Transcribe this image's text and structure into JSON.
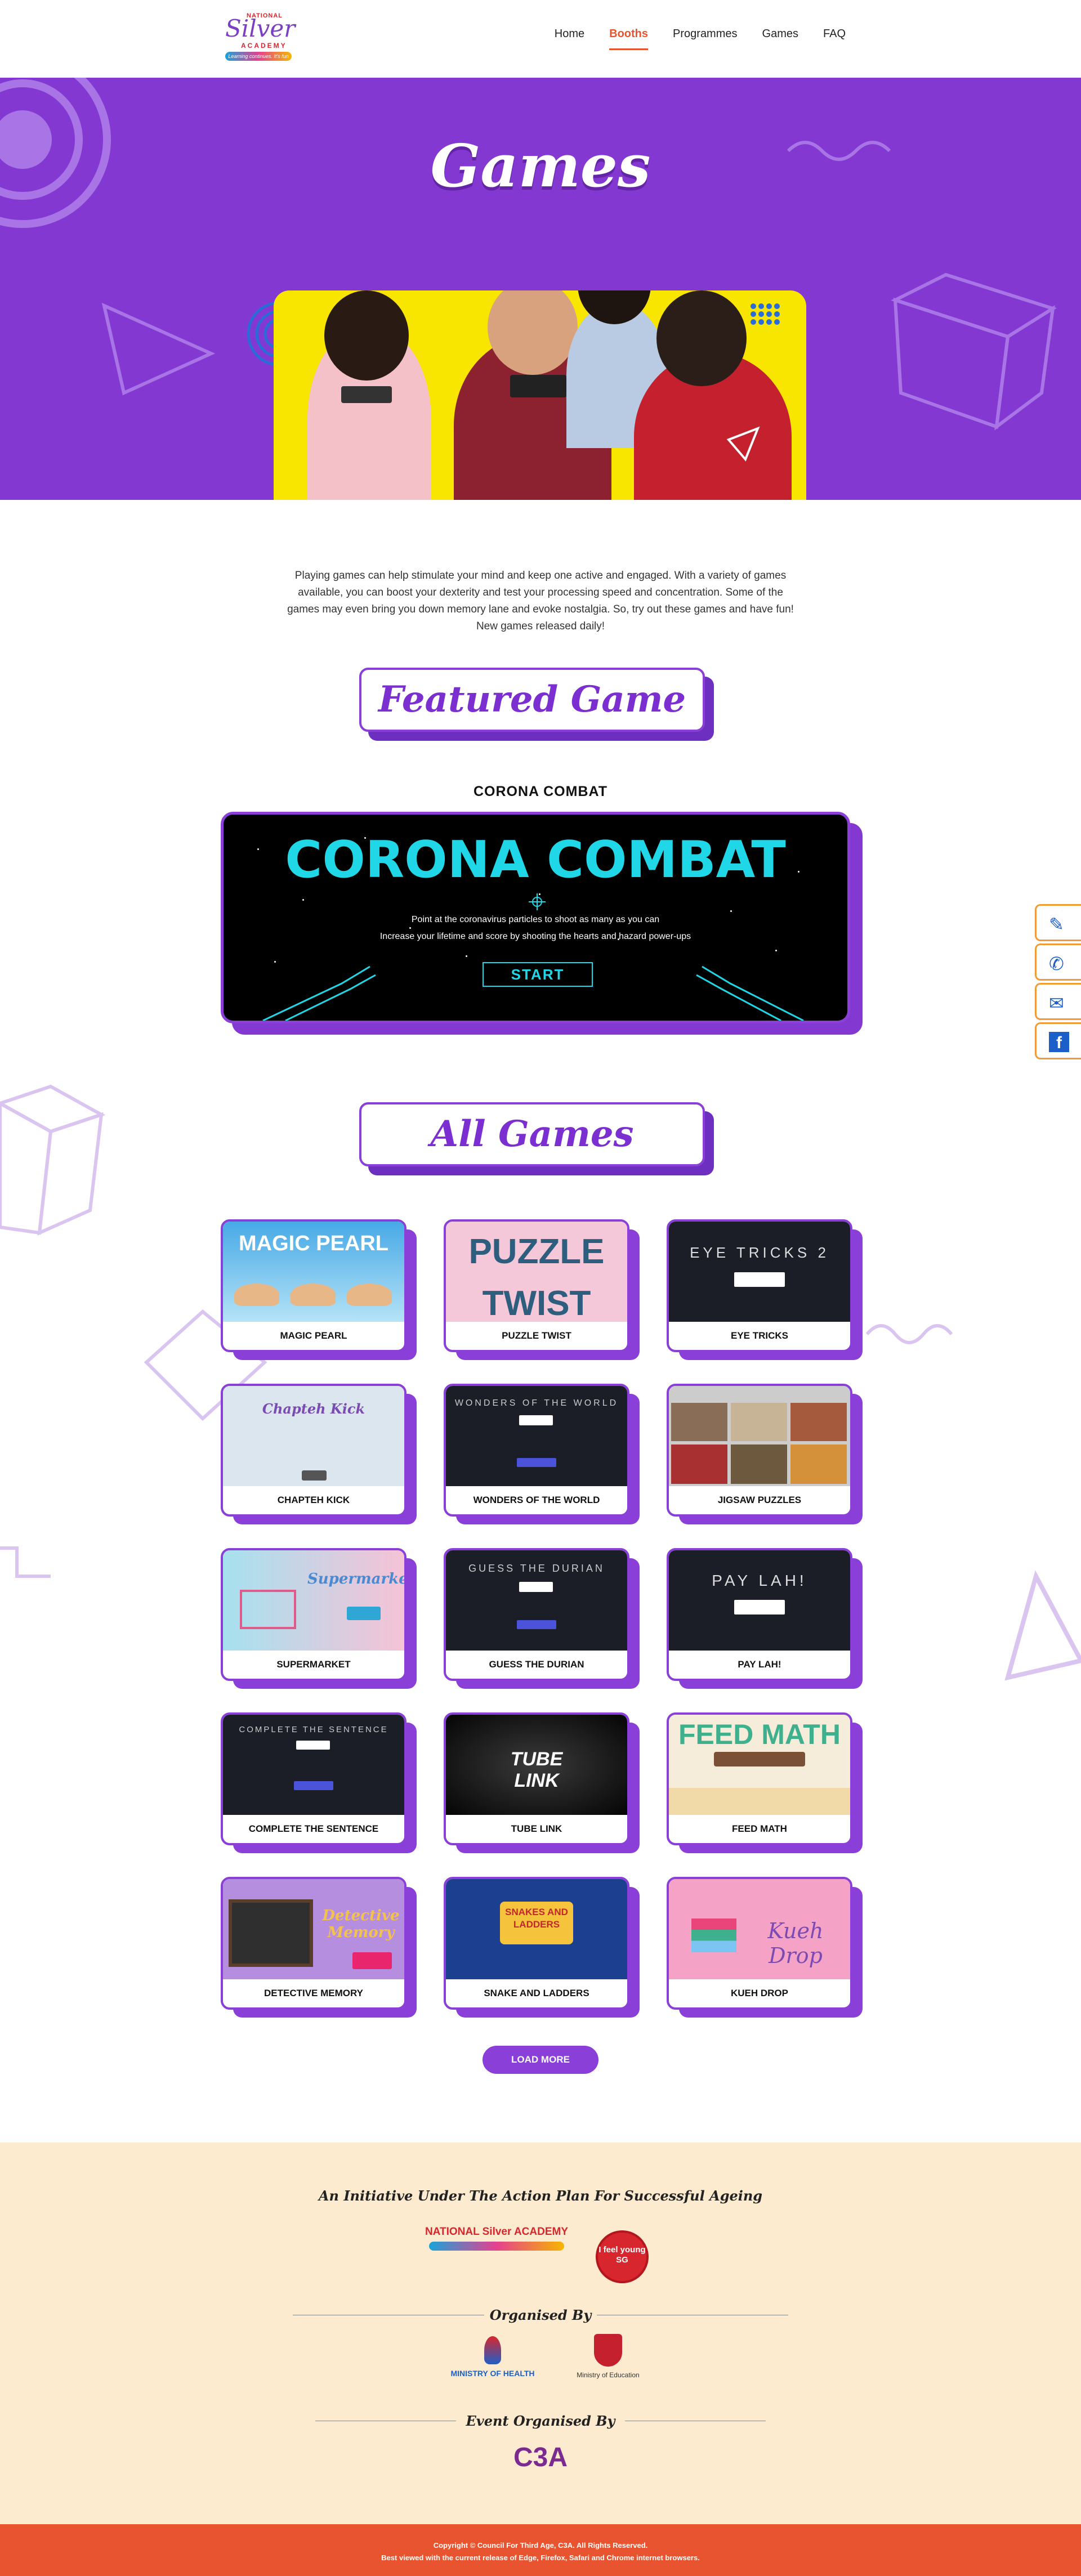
{
  "header": {
    "logo": {
      "national": "NATIONAL",
      "silver": "Silver",
      "academy": "ACADEMY",
      "tagline": "Learning continues. It's fun"
    },
    "nav": [
      {
        "label": "Home",
        "active": false
      },
      {
        "label": "Booths",
        "active": true
      },
      {
        "label": "Programmes",
        "active": false
      },
      {
        "label": "Games",
        "active": false
      },
      {
        "label": "FAQ",
        "active": false
      }
    ]
  },
  "hero": {
    "title": "Games",
    "background": "#8339d1",
    "photo_background": "#f8e500"
  },
  "intro": "Playing games can help stimulate your mind and keep one active and engaged. With a variety of games available, you can boost your dexterity and test your processing speed and concentration. Some of the games may even bring you down memory lane and evoke nostalgia. So, try out these games and have fun! New games released daily!",
  "featured": {
    "section_title": "Featured Game",
    "game_name": "CORONA COMBAT",
    "screen_title": "CORONA COMBAT",
    "line1": "Point at the coronavirus particles to shoot as many as you can",
    "line2": "Increase your lifetime and score by shooting the hearts and hazard power-ups",
    "start_label": "START"
  },
  "all_games": {
    "section_title": "All Games",
    "games": [
      {
        "name": "MAGIC PEARL",
        "thumb_text": "MAGIC PEARL"
      },
      {
        "name": "PUZZLE TWIST",
        "thumb_text": "PUZZLE TWIST"
      },
      {
        "name": "EYE TRICKS",
        "thumb_text": "EYE TRICKS 2"
      },
      {
        "name": "CHAPTEH KICK",
        "thumb_text": "Chapteh Kick"
      },
      {
        "name": "WONDERS OF THE WORLD",
        "thumb_text": "WONDERS OF THE WORLD"
      },
      {
        "name": "JIGSAW PUZZLES",
        "thumb_text": ""
      },
      {
        "name": "SUPERMARKET",
        "thumb_text": "Supermarket"
      },
      {
        "name": "GUESS THE DURIAN",
        "thumb_text": "GUESS THE DURIAN"
      },
      {
        "name": "PAY LAH!",
        "thumb_text": "PAY LAH!"
      },
      {
        "name": "COMPLETE THE SENTENCE",
        "thumb_text": "COMPLETE THE SENTENCE"
      },
      {
        "name": "TUBE LINK",
        "thumb_text": "TUBE LINK"
      },
      {
        "name": "FEED MATH",
        "thumb_text": "FEED MATH"
      },
      {
        "name": "DETECTIVE MEMORY",
        "thumb_text": "Detective Memory"
      },
      {
        "name": "SNAKE AND LADDERS",
        "thumb_text": "SNAKES AND LADDERS"
      },
      {
        "name": "KUEH DROP",
        "thumb_text": "Kueh Drop"
      }
    ],
    "load_more_label": "LOAD MORE"
  },
  "sponsors": {
    "initiative": "An Initiative Under The Action Plan For Successful Ageing",
    "logos_top": [
      "NATIONAL Silver ACADEMY",
      "I feel young SG"
    ],
    "organised_by": "Organised By",
    "organisers": [
      "MINISTRY OF HEALTH",
      "Ministry of Education"
    ],
    "event_organised_by": "Event Organised By",
    "event_organiser": "C3A"
  },
  "footer": {
    "copyright": "Copyright © Council For Third Age, C3A. All Rights Reserved.",
    "browser_note": "Best viewed with the current release of Edge, Firefox, Safari and Chrome internet browsers."
  },
  "colors": {
    "primary": "#8a3fd8",
    "accent": "#e8542f",
    "footer_bg": "#fdebd0"
  },
  "side_buttons": [
    "feather-icon",
    "phone-icon",
    "mail-icon",
    "facebook-icon"
  ]
}
